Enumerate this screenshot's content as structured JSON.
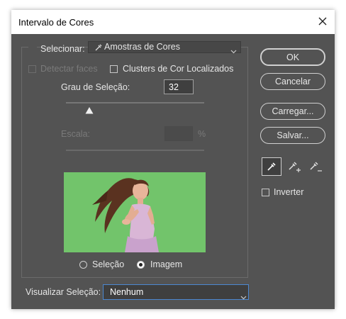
{
  "window": {
    "title": "Intervalo de Cores"
  },
  "select": {
    "label": "Selecionar:",
    "value": "Amostras de Cores",
    "icon": "eyedropper-icon"
  },
  "options": {
    "detect_faces": "Detectar faces",
    "localized_clusters": "Clusters de Cor Localizados"
  },
  "fuzziness": {
    "label": "Grau de Seleção:",
    "value": "32",
    "slider_level": 0.17
  },
  "range": {
    "label": "Escala:",
    "unit": "%"
  },
  "preview": {
    "radio_selection": "Seleção",
    "radio_image": "Imagem",
    "selected": "Imagem",
    "background_color": "#72c46b"
  },
  "buttons": {
    "ok": "OK",
    "cancel": "Cancelar",
    "load": "Carregar...",
    "save": "Salvar..."
  },
  "tools": [
    "eyedropper-icon",
    "eyedropper-plus-icon",
    "eyedropper-minus-icon"
  ],
  "invert": {
    "label": "Inverter"
  },
  "preview_mode": {
    "label": "Visualizar Seleção:",
    "value": "Nenhum"
  }
}
